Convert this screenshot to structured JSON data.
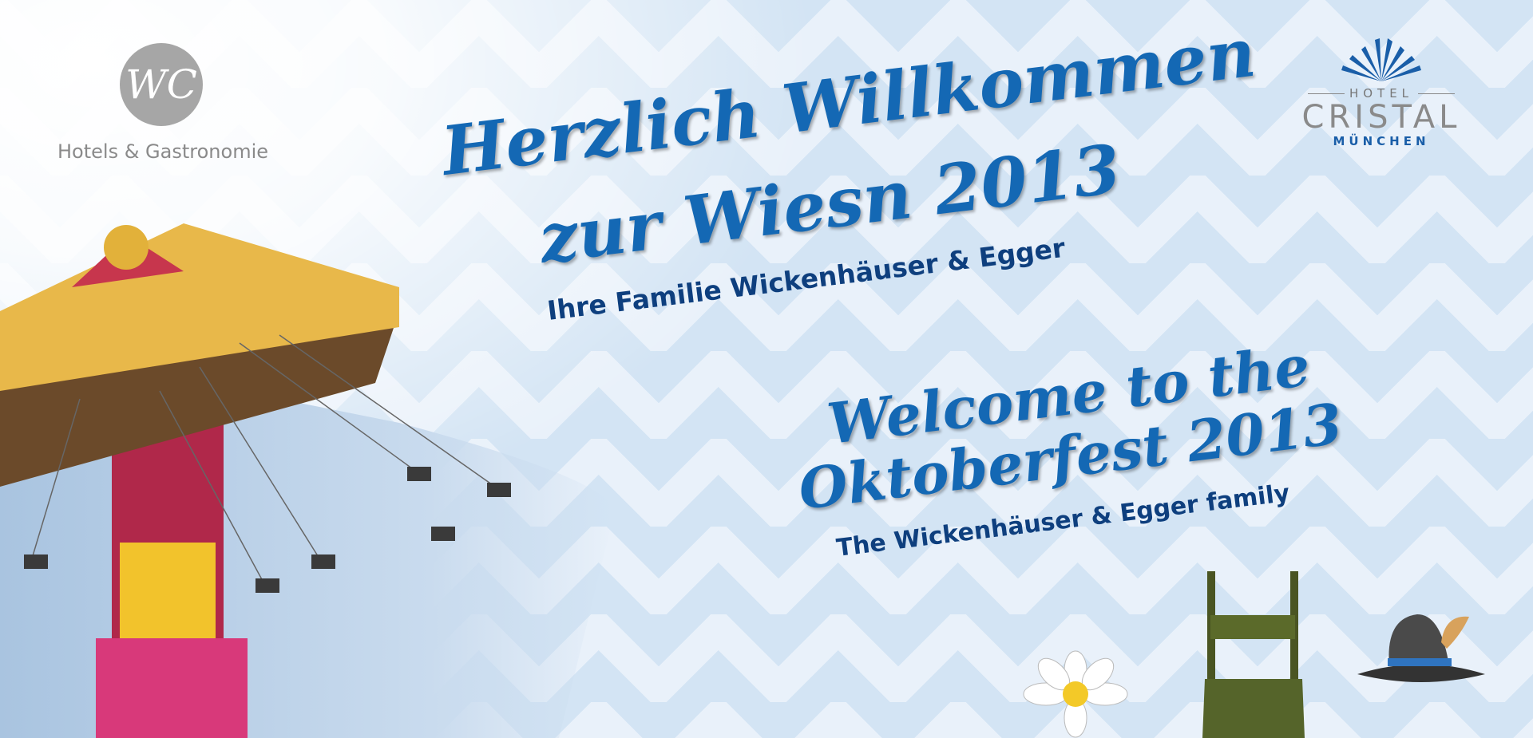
{
  "left_logo": {
    "monogram": "WC",
    "tagline": "Hotels & Gastronomie"
  },
  "right_logo": {
    "line1": "HOTEL",
    "line2": "CRISTAL",
    "line3": "MÜNCHEN"
  },
  "german": {
    "headline1": "Herzlich Willkommen",
    "headline2": "zur Wiesn 2013",
    "signature": "Ihre Familie Wickenhäuser & Egger"
  },
  "english": {
    "headline1": "Welcome to the",
    "headline2": "Oktoberfest 2013",
    "signature": "The Wickenhäuser & Egger family"
  },
  "colors": {
    "headline": "#1468b4",
    "signature": "#0e3f7e",
    "diamond": "#d3e4f4"
  }
}
